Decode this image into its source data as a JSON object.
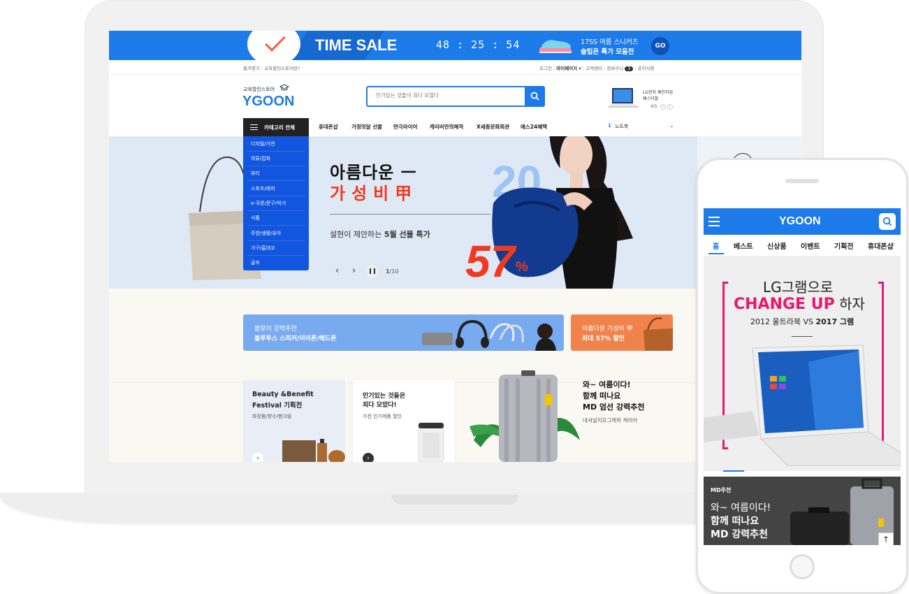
{
  "timesale": {
    "title": "TIME SALE",
    "timer": "48 : 25 : 54",
    "promo_line1": "17SS 여름 스니커즈",
    "promo_line2": "슬립온 특가 모음전",
    "go": "GO"
  },
  "util": {
    "left": [
      "즐겨찾기",
      "교육할인스토어란?"
    ],
    "right": [
      "로그인",
      "마이페이지 ▾",
      "고객센터",
      "장바구니",
      "공지사항"
    ],
    "cart_count": "3"
  },
  "header": {
    "logo_sub": "교육할인스토어",
    "logo": "YGOON",
    "search_placeholder": "인기있는 것들이 죄다 모였다",
    "lg_label1": "LG전자 페인지업",
    "lg_label2": "페스티벌",
    "lg_page": "4/5"
  },
  "nav": {
    "category_all": "카테고리 전체",
    "categories": [
      "디지털/가전",
      "의류/잡화",
      "뷰티",
      "스포츠/레저",
      "e-쿠폰/문구/악기",
      "식품",
      "주방/생활/유아",
      "가구/홈데코",
      "골프"
    ],
    "menu": [
      "휴대폰샵",
      "가정의달 선물",
      "연극라이어",
      "캐리비안의해적",
      "X세종문화회관",
      "예스24혜택"
    ],
    "rank_num": "1",
    "rank_label": "노트북"
  },
  "hero": {
    "line1": "아름다운 ㅡ",
    "line2": "가성비甲",
    "big_num": "20",
    "subtitle_plain": "설현이 제안하는 ",
    "subtitle_bold": "5월 선물 특가",
    "discount": "57",
    "discount_unit": "%",
    "page_current": "1",
    "page_total": "/10"
  },
  "banners": {
    "b1_small": "봄맞이 강력추천",
    "b1_bold": "블루투스 스피커/이어폰/헤드폰",
    "b2_small": "아름다운 가성비 甲",
    "b2_bold": "최대 57% 할인"
  },
  "cards": {
    "c1_title1": "Beauty &Benefit",
    "c1_title2": "Festival 기획전",
    "c1_sub": "화장품/향수/펜크림",
    "c2_title1": "인기있는 것들은",
    "c2_title2": "죄다 모았다!",
    "c2_sub": "가전 인기제품 할인"
  },
  "summer": {
    "t1": "와~ 여름이다!",
    "t2": "함께 떠나요",
    "t3": "MD 엄선 강력추천",
    "sub": "내셔널지오그래픽 캐리어"
  },
  "phone": {
    "logo": "YGOON",
    "tabs": [
      "홈",
      "베스트",
      "신상품",
      "이벤트",
      "기획전",
      "휴대폰샵"
    ],
    "banner_line1": "LG그램으로",
    "banner_line2_pink": "CHANGE UP",
    "banner_line2_dark": " 하자",
    "banner_line3_plain": "2012 울트라북 VS ",
    "banner_line3_bold": "2017 그램",
    "md_label": "MD추천",
    "md_t1": "와~ 여름이다!",
    "md_t2": "함께 떠나요",
    "md_t3": "MD 강력추천"
  },
  "colors": {
    "brand_blue": "#1d7be9",
    "category_blue": "#1256e0",
    "sale_red": "#f0391f",
    "pink": "#e8186b"
  }
}
